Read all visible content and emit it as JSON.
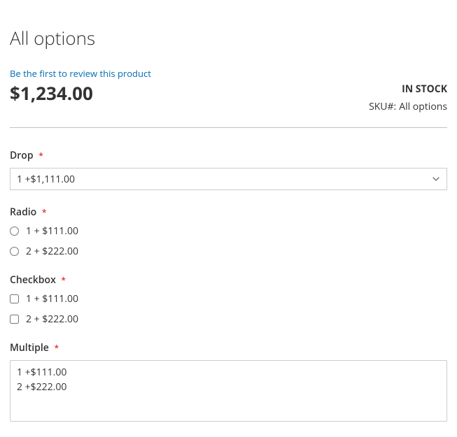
{
  "title": "All options",
  "reviews_link": "Be the first to review this product",
  "price": "$1,234.00",
  "stock": "IN STOCK",
  "sku_label": "SKU#:",
  "sku_value": "All options",
  "fields": {
    "drop": {
      "label": "Drop",
      "selected": "1 +$1,111.00"
    },
    "radio": {
      "label": "Radio",
      "options": [
        {
          "label": "1 + $111.00"
        },
        {
          "label": "2 + $222.00"
        }
      ]
    },
    "checkbox": {
      "label": "Checkbox",
      "options": [
        {
          "label": "1 + $111.00"
        },
        {
          "label": "2 + $222.00"
        }
      ]
    },
    "multiple": {
      "label": "Multiple",
      "options": [
        {
          "label": "1 +$111.00"
        },
        {
          "label": "2 +$222.00"
        }
      ]
    }
  },
  "required_mark": "*"
}
